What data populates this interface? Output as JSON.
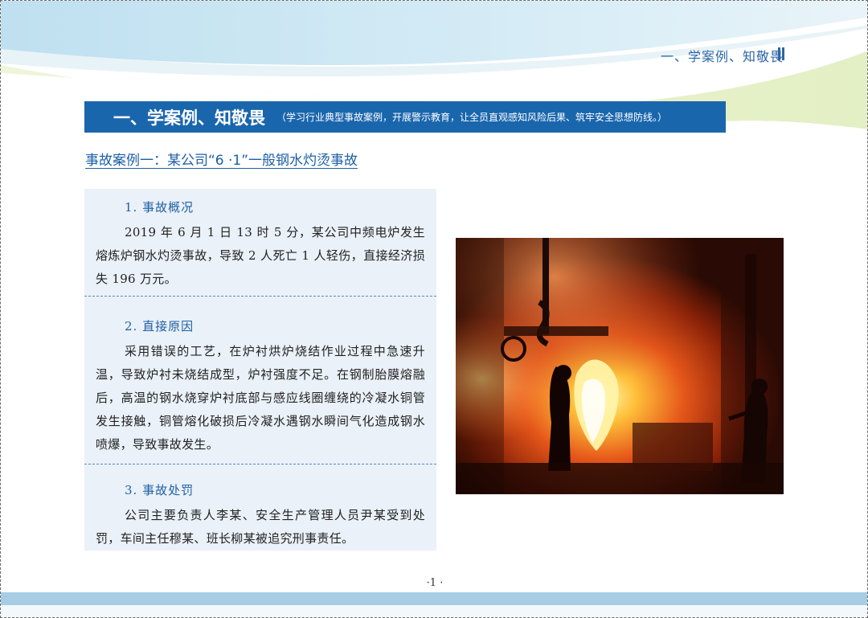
{
  "header": {
    "title": "一、学案例、知敬畏"
  },
  "section": {
    "title": "一、学案例、知敬畏",
    "subtitle": "（学习行业典型事故案例，开展警示教育，让全员直观感知风险后果、筑牢安全思想防线。）"
  },
  "case_title": "事故案例一：某公司“6 ·1”一般钢水灼烫事故",
  "blocks": [
    {
      "heading": "1. 事故概况",
      "text": "2019 年 6 月 1 日 13 时 5 分，某公司中频电炉发生熔炼炉钢水灼烫事故，导致 2 人死亡 1 人轻伤，直接经济损失 196 万元。"
    },
    {
      "heading": "2. 直接原因",
      "text": "采用错误的工艺，在炉衬烘炉烧结作业过程中急速升温，导致炉衬未烧结成型，炉衬强度不足。在钢制胎膜熔融后，高温的钢水烧穿炉衬底部与感应线圈缠绕的冷凝水铜管发生接触，铜管熔化破损后冷凝水遇钢水瞬间气化造成钢水喷爆，导致事故发生。"
    },
    {
      "heading": "3. 事故处罚",
      "text": "公司主要负责人李某、安全生产管理人员尹某受到处罚，车间主任穆某、班长柳某被追究刑事责任。"
    }
  ],
  "page_number": "·1 ·",
  "colors": {
    "banner": "#1a66ad",
    "accent": "#1f5fa5",
    "panel": "#eaf1f8"
  }
}
